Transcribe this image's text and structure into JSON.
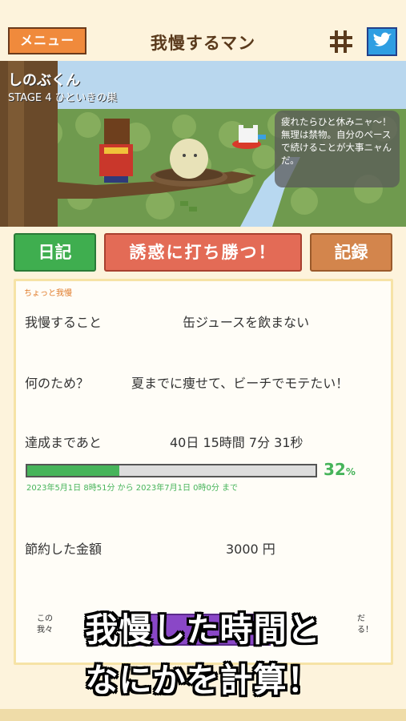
{
  "header": {
    "menu_label": "メニュー",
    "title": "我慢するマン",
    "hash_icon": "hashtag-icon",
    "twitter_icon": "twitter-bird-icon"
  },
  "scene": {
    "character_name": "しのぶくん",
    "stage_label": "STAGE 4  ひといきの巣",
    "speech": "疲れたらひと休みニャ〜！\n無理は禁物。自分のペースで続けることが大事ニャんだ。"
  },
  "actions": {
    "diary_label": "日記",
    "resist_label": "誘惑に打ち勝つ！",
    "record_label": "記録"
  },
  "panel": {
    "tag": "ちょっと我慢",
    "rows": [
      {
        "label": "我慢すること",
        "value": "缶ジュースを飲まない"
      },
      {
        "label": "何のため？",
        "value": "夏までに痩せて、ビーチでモテたい！"
      },
      {
        "label": "達成まであと",
        "value": "40日 15時間 7分 31秒"
      },
      {
        "label": "節約した金額",
        "value": "3000 円"
      }
    ],
    "progress_percent": 32,
    "progress_text": "32",
    "progress_unit": "%",
    "period": "2023年5月1日 8時51分 から 2023年7月1日 0時0分 まで",
    "note_left": "この\n我々",
    "note_right": "だ\nる！"
  },
  "caption": {
    "line1": "我慢した時間と",
    "line2": "なにかを計算！"
  },
  "colors": {
    "menu": "#f08a3c",
    "diary": "#3fae4f",
    "resist": "#e36b56",
    "record": "#d3854c",
    "progress": "#46b45a"
  }
}
